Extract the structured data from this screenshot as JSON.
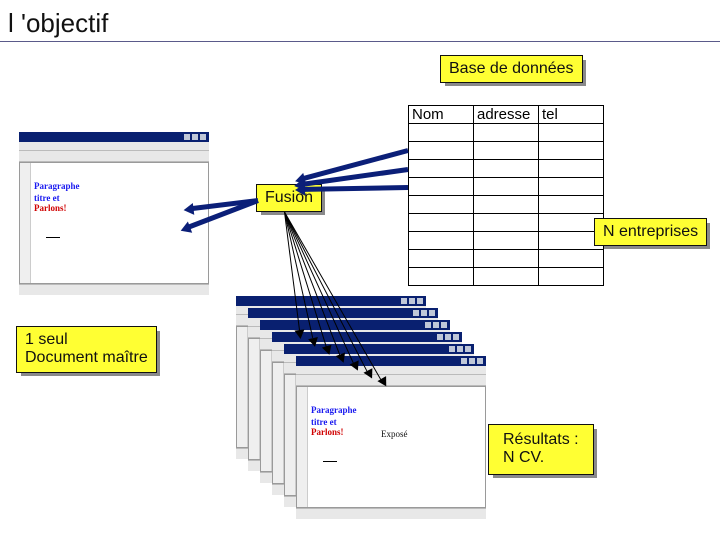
{
  "title": "l 'objectif",
  "labels": {
    "database": "Base de données",
    "fusion": "Fusion",
    "n_entreprises": "N entreprises",
    "master_line1": "1 seul",
    "master_line2": "Document maître",
    "results_line1": "Résultats :",
    "results_line2": "N CV."
  },
  "table": {
    "headers": [
      "Nom",
      "adresse",
      "tel"
    ],
    "rows": 9
  },
  "win_text": {
    "line1": "Paragraphe",
    "line2": "titre et",
    "line3": "Parlons!",
    "line4": "Exposé"
  }
}
